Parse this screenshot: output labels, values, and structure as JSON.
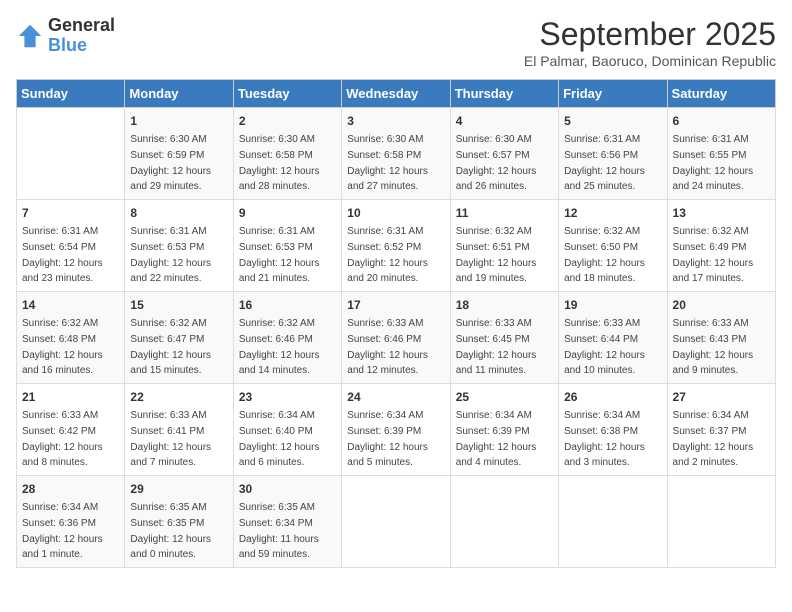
{
  "logo": {
    "general": "General",
    "blue": "Blue"
  },
  "header": {
    "month": "September 2025",
    "location": "El Palmar, Baoruco, Dominican Republic"
  },
  "days_of_week": [
    "Sunday",
    "Monday",
    "Tuesday",
    "Wednesday",
    "Thursday",
    "Friday",
    "Saturday"
  ],
  "weeks": [
    [
      {
        "day": "",
        "sunrise": "",
        "sunset": "",
        "daylight": ""
      },
      {
        "day": "1",
        "sunrise": "Sunrise: 6:30 AM",
        "sunset": "Sunset: 6:59 PM",
        "daylight": "Daylight: 12 hours and 29 minutes."
      },
      {
        "day": "2",
        "sunrise": "Sunrise: 6:30 AM",
        "sunset": "Sunset: 6:58 PM",
        "daylight": "Daylight: 12 hours and 28 minutes."
      },
      {
        "day": "3",
        "sunrise": "Sunrise: 6:30 AM",
        "sunset": "Sunset: 6:58 PM",
        "daylight": "Daylight: 12 hours and 27 minutes."
      },
      {
        "day": "4",
        "sunrise": "Sunrise: 6:30 AM",
        "sunset": "Sunset: 6:57 PM",
        "daylight": "Daylight: 12 hours and 26 minutes."
      },
      {
        "day": "5",
        "sunrise": "Sunrise: 6:31 AM",
        "sunset": "Sunset: 6:56 PM",
        "daylight": "Daylight: 12 hours and 25 minutes."
      },
      {
        "day": "6",
        "sunrise": "Sunrise: 6:31 AM",
        "sunset": "Sunset: 6:55 PM",
        "daylight": "Daylight: 12 hours and 24 minutes."
      }
    ],
    [
      {
        "day": "7",
        "sunrise": "Sunrise: 6:31 AM",
        "sunset": "Sunset: 6:54 PM",
        "daylight": "Daylight: 12 hours and 23 minutes."
      },
      {
        "day": "8",
        "sunrise": "Sunrise: 6:31 AM",
        "sunset": "Sunset: 6:53 PM",
        "daylight": "Daylight: 12 hours and 22 minutes."
      },
      {
        "day": "9",
        "sunrise": "Sunrise: 6:31 AM",
        "sunset": "Sunset: 6:53 PM",
        "daylight": "Daylight: 12 hours and 21 minutes."
      },
      {
        "day": "10",
        "sunrise": "Sunrise: 6:31 AM",
        "sunset": "Sunset: 6:52 PM",
        "daylight": "Daylight: 12 hours and 20 minutes."
      },
      {
        "day": "11",
        "sunrise": "Sunrise: 6:32 AM",
        "sunset": "Sunset: 6:51 PM",
        "daylight": "Daylight: 12 hours and 19 minutes."
      },
      {
        "day": "12",
        "sunrise": "Sunrise: 6:32 AM",
        "sunset": "Sunset: 6:50 PM",
        "daylight": "Daylight: 12 hours and 18 minutes."
      },
      {
        "day": "13",
        "sunrise": "Sunrise: 6:32 AM",
        "sunset": "Sunset: 6:49 PM",
        "daylight": "Daylight: 12 hours and 17 minutes."
      }
    ],
    [
      {
        "day": "14",
        "sunrise": "Sunrise: 6:32 AM",
        "sunset": "Sunset: 6:48 PM",
        "daylight": "Daylight: 12 hours and 16 minutes."
      },
      {
        "day": "15",
        "sunrise": "Sunrise: 6:32 AM",
        "sunset": "Sunset: 6:47 PM",
        "daylight": "Daylight: 12 hours and 15 minutes."
      },
      {
        "day": "16",
        "sunrise": "Sunrise: 6:32 AM",
        "sunset": "Sunset: 6:46 PM",
        "daylight": "Daylight: 12 hours and 14 minutes."
      },
      {
        "day": "17",
        "sunrise": "Sunrise: 6:33 AM",
        "sunset": "Sunset: 6:46 PM",
        "daylight": "Daylight: 12 hours and 12 minutes."
      },
      {
        "day": "18",
        "sunrise": "Sunrise: 6:33 AM",
        "sunset": "Sunset: 6:45 PM",
        "daylight": "Daylight: 12 hours and 11 minutes."
      },
      {
        "day": "19",
        "sunrise": "Sunrise: 6:33 AM",
        "sunset": "Sunset: 6:44 PM",
        "daylight": "Daylight: 12 hours and 10 minutes."
      },
      {
        "day": "20",
        "sunrise": "Sunrise: 6:33 AM",
        "sunset": "Sunset: 6:43 PM",
        "daylight": "Daylight: 12 hours and 9 minutes."
      }
    ],
    [
      {
        "day": "21",
        "sunrise": "Sunrise: 6:33 AM",
        "sunset": "Sunset: 6:42 PM",
        "daylight": "Daylight: 12 hours and 8 minutes."
      },
      {
        "day": "22",
        "sunrise": "Sunrise: 6:33 AM",
        "sunset": "Sunset: 6:41 PM",
        "daylight": "Daylight: 12 hours and 7 minutes."
      },
      {
        "day": "23",
        "sunrise": "Sunrise: 6:34 AM",
        "sunset": "Sunset: 6:40 PM",
        "daylight": "Daylight: 12 hours and 6 minutes."
      },
      {
        "day": "24",
        "sunrise": "Sunrise: 6:34 AM",
        "sunset": "Sunset: 6:39 PM",
        "daylight": "Daylight: 12 hours and 5 minutes."
      },
      {
        "day": "25",
        "sunrise": "Sunrise: 6:34 AM",
        "sunset": "Sunset: 6:39 PM",
        "daylight": "Daylight: 12 hours and 4 minutes."
      },
      {
        "day": "26",
        "sunrise": "Sunrise: 6:34 AM",
        "sunset": "Sunset: 6:38 PM",
        "daylight": "Daylight: 12 hours and 3 minutes."
      },
      {
        "day": "27",
        "sunrise": "Sunrise: 6:34 AM",
        "sunset": "Sunset: 6:37 PM",
        "daylight": "Daylight: 12 hours and 2 minutes."
      }
    ],
    [
      {
        "day": "28",
        "sunrise": "Sunrise: 6:34 AM",
        "sunset": "Sunset: 6:36 PM",
        "daylight": "Daylight: 12 hours and 1 minute."
      },
      {
        "day": "29",
        "sunrise": "Sunrise: 6:35 AM",
        "sunset": "Sunset: 6:35 PM",
        "daylight": "Daylight: 12 hours and 0 minutes."
      },
      {
        "day": "30",
        "sunrise": "Sunrise: 6:35 AM",
        "sunset": "Sunset: 6:34 PM",
        "daylight": "Daylight: 11 hours and 59 minutes."
      },
      {
        "day": "",
        "sunrise": "",
        "sunset": "",
        "daylight": ""
      },
      {
        "day": "",
        "sunrise": "",
        "sunset": "",
        "daylight": ""
      },
      {
        "day": "",
        "sunrise": "",
        "sunset": "",
        "daylight": ""
      },
      {
        "day": "",
        "sunrise": "",
        "sunset": "",
        "daylight": ""
      }
    ]
  ]
}
